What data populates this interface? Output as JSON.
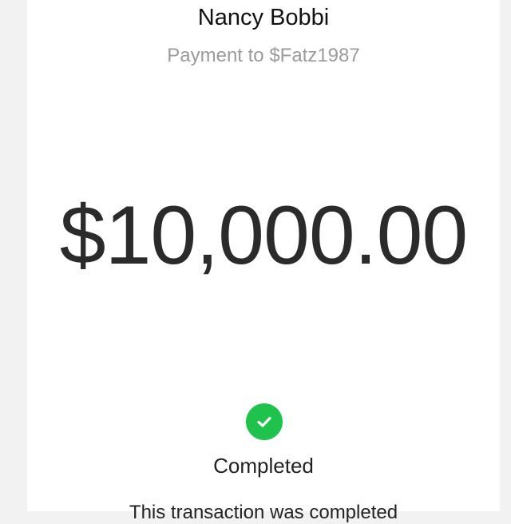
{
  "recipient": {
    "name": "Nancy Bobbi",
    "subtitle": "Payment to $Fatz1987"
  },
  "payment": {
    "amount": "$10,000.00",
    "status": "Completed",
    "status_color": "#1fc24b",
    "status_icon": "check-icon"
  },
  "footer": {
    "text": "This transaction was completed"
  }
}
